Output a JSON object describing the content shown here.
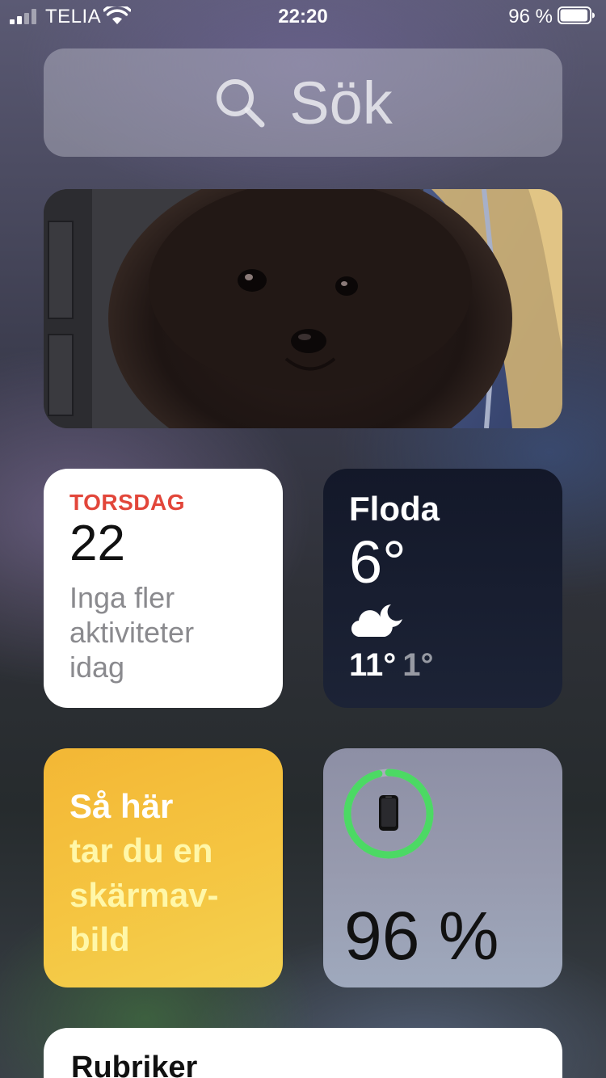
{
  "status_bar": {
    "carrier": "TELIA",
    "time": "22:20",
    "battery_percent": "96 %",
    "battery_level": 0.96,
    "signal_bars": 2
  },
  "search": {
    "label": "Sök",
    "icon": "search-icon"
  },
  "photo_widget": {
    "icon": "photo"
  },
  "calendar": {
    "day": "TORSDAG",
    "date": "22",
    "message": "Inga fler aktiviteter idag"
  },
  "weather": {
    "city": "Floda",
    "temperature": "6°",
    "condition_icon": "partly-cloudy-night-icon",
    "high": "11°",
    "low": "1°"
  },
  "tips": {
    "title": "Så här",
    "body": "tar du en skärmav-bild"
  },
  "battery_widget": {
    "value": "96 %",
    "level": 0.96,
    "device_icon": "iphone-icon",
    "ring_color": "#4cd964"
  },
  "news": {
    "title": "Rubriker"
  }
}
